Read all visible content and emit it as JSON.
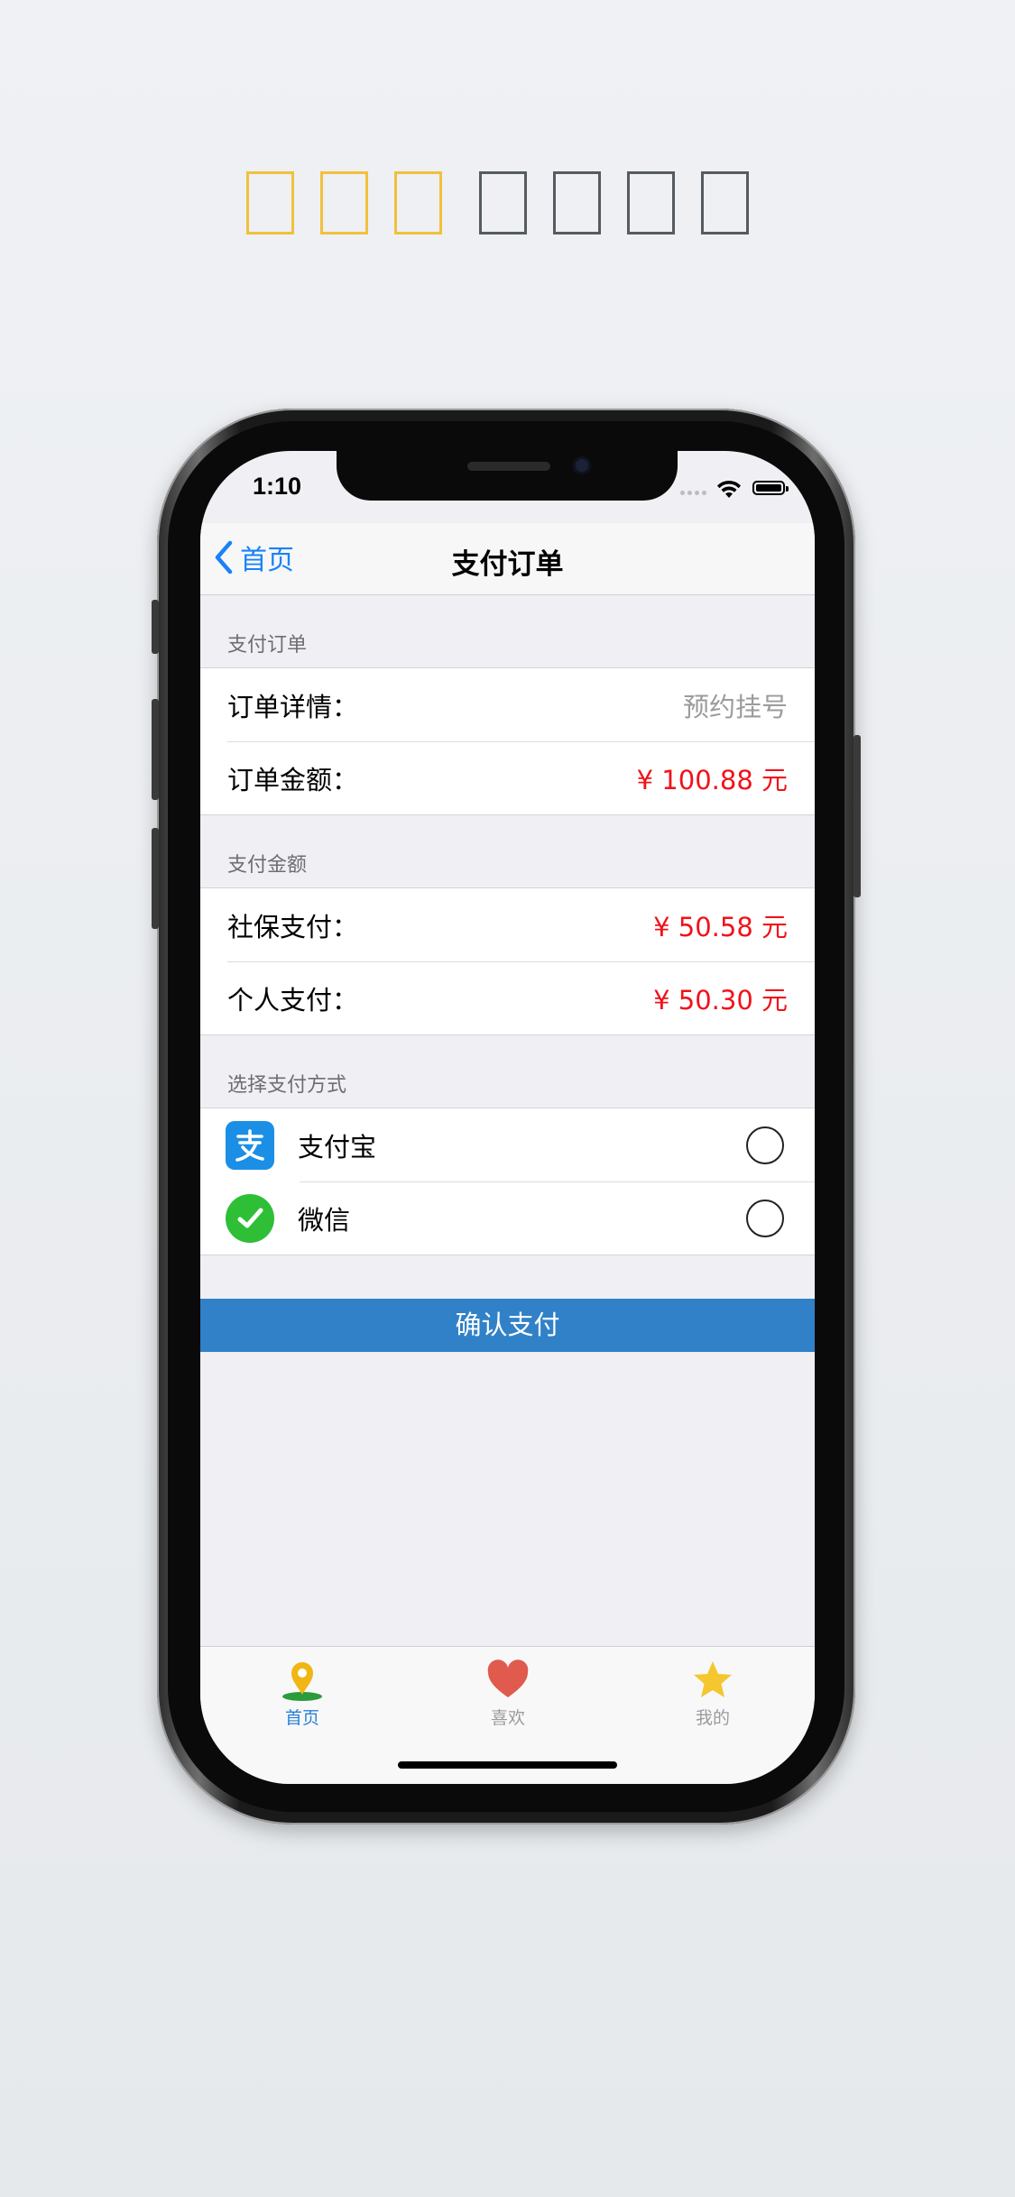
{
  "header_boxes": [
    {
      "state": "filled",
      "color": "#f1c13b"
    },
    {
      "state": "filled",
      "color": "#f1c13b"
    },
    {
      "state": "filled",
      "color": "#f1c13b"
    },
    {
      "state": "empty",
      "color": "#555b61"
    },
    {
      "state": "empty",
      "color": "#555b61"
    },
    {
      "state": "empty",
      "color": "#555b61"
    },
    {
      "state": "empty",
      "color": "#555b61"
    }
  ],
  "status_bar": {
    "time": "1:10",
    "icons": [
      "signal-dots-icon",
      "wifi-icon",
      "battery-icon"
    ]
  },
  "nav": {
    "back_label": "首页",
    "title": "支付订单"
  },
  "sections": {
    "order": {
      "header": "支付订单",
      "rows": [
        {
          "label": "订单详情：",
          "value": "预约挂号"
        },
        {
          "label": "订单金额：",
          "value": "¥ 100.88 元"
        }
      ]
    },
    "amount": {
      "header": "支付金额",
      "rows": [
        {
          "label": "社保支付：",
          "value": "¥ 50.58 元"
        },
        {
          "label": "个人支付：",
          "value": "¥ 50.30 元"
        }
      ]
    },
    "method": {
      "header": "选择支付方式",
      "options": [
        {
          "name": "支付宝",
          "icon": "alipay-icon",
          "selected": false
        },
        {
          "name": "微信",
          "icon": "wechat-icon",
          "selected": false
        }
      ]
    }
  },
  "confirm_button": "确认支付",
  "tabbar": {
    "tabs": [
      {
        "label": "首页",
        "icon": "map-pin-icon",
        "active": true
      },
      {
        "label": "喜欢",
        "icon": "heart-icon",
        "active": false
      },
      {
        "label": "我的",
        "icon": "star-icon",
        "active": false
      }
    ]
  },
  "colors": {
    "accent": "#1a82f8",
    "price_red": "#f1121a",
    "confirm_blue": "#3181c8",
    "gold": "#f1c13b"
  }
}
